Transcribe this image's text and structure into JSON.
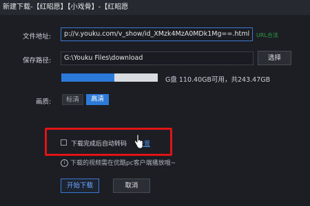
{
  "window": {
    "title": "新建下载-【红昭愿】【小戏骨】-【红昭愿"
  },
  "form": {
    "url_label": "文件地址:",
    "url_value": "p://v.youku.com/v_show/id_XMzk4MzA0MDk1Mg==.html",
    "url_status": "URL合法",
    "path_label": "保存路径:",
    "path_value": "G:\\Youku Files\\download",
    "browse_label": "选择",
    "disk_text": "G盘 110.40GB可用，共243.47GB",
    "disk_usage_fraction": 0.55,
    "quality_label": "画质:",
    "quality_options": [
      "标清",
      "高清"
    ],
    "quality_selected": "高清",
    "auto_transcode_label": "下载完成后自动转码",
    "auto_transcode_checked": false,
    "settings_link": "设置",
    "info_text": "下载的视频需在优酷pc客户端播放哦~",
    "start_label": "开始下载",
    "cancel_label": "取消"
  }
}
